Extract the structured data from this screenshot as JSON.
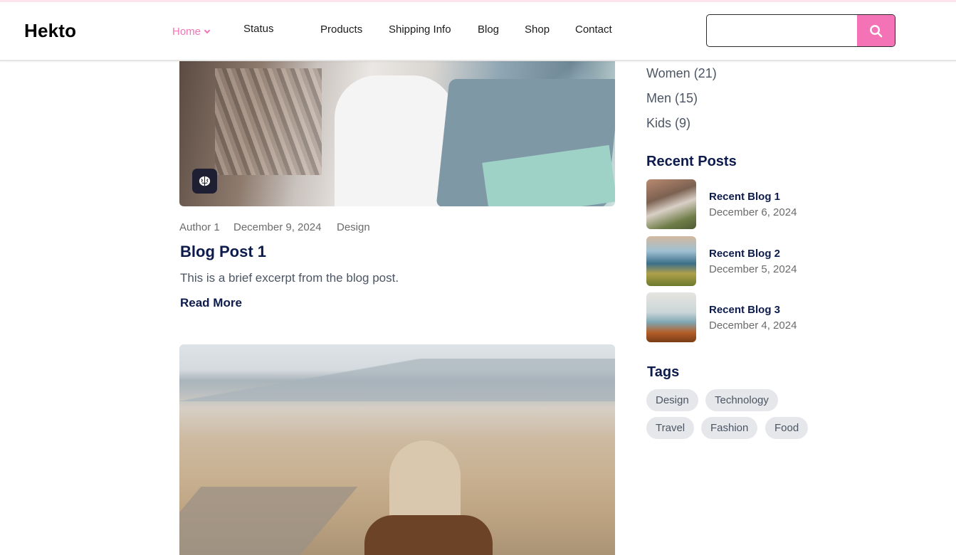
{
  "header": {
    "logo": "Hekto",
    "nav": [
      {
        "label": "Home"
      },
      {
        "label": "Status"
      },
      {
        "label": "Products"
      },
      {
        "label": "Shipping Info"
      },
      {
        "label": "Blog"
      },
      {
        "label": "Shop"
      },
      {
        "label": "Contact"
      }
    ],
    "search": {
      "placeholder": "",
      "value": ""
    }
  },
  "main": {
    "post1": {
      "author": "Author 1",
      "date": "December 9, 2024",
      "category": "Design",
      "title": "Blog Post 1",
      "excerpt": "This is a brief excerpt from the blog post.",
      "read_more": "Read More"
    }
  },
  "sidebar": {
    "categories": [
      {
        "label": "Women (21)"
      },
      {
        "label": "Men (15)"
      },
      {
        "label": "Kids (9)"
      }
    ],
    "recent_heading": "Recent Posts",
    "recent_posts": [
      {
        "title": "Recent Blog 1",
        "date": "December 6, 2024"
      },
      {
        "title": "Recent Blog 2",
        "date": "December 5, 2024"
      },
      {
        "title": "Recent Blog 3",
        "date": "December 4, 2024"
      }
    ],
    "tags_heading": "Tags",
    "tags": [
      "Design",
      "Technology",
      "Travel",
      "Fashion",
      "Food"
    ]
  },
  "colors": {
    "accent": "#f472b6",
    "heading": "#0d1b4c",
    "muted": "#6b6b6b",
    "tag_bg": "#e5e7eb"
  }
}
